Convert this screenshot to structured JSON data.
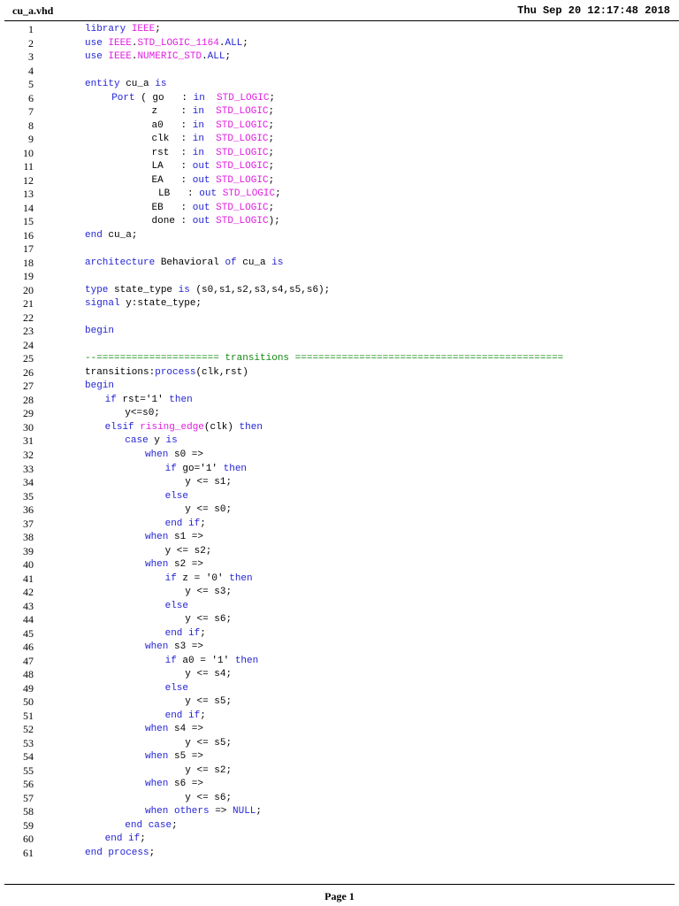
{
  "header": {
    "filename": "cu_a.vhd",
    "datetime": "Thu Sep 20 12:17:48 2018"
  },
  "footer": {
    "page": "Page 1"
  },
  "colors": {
    "keyword": "#2424d4",
    "type": "#e01ee0",
    "comment": "#128a12"
  },
  "lines": [
    {
      "n": "1",
      "tokens": [
        [
          "k",
          "library"
        ],
        [
          "p",
          " "
        ],
        [
          "m",
          "IEEE"
        ],
        [
          "p",
          ";"
        ]
      ]
    },
    {
      "n": "2",
      "tokens": [
        [
          "k",
          "use"
        ],
        [
          "p",
          " "
        ],
        [
          "m",
          "IEEE"
        ],
        [
          "p",
          "."
        ],
        [
          "m",
          "STD_LOGIC_1164"
        ],
        [
          "p",
          "."
        ],
        [
          "k",
          "ALL"
        ],
        [
          "p",
          ";"
        ]
      ]
    },
    {
      "n": "3",
      "tokens": [
        [
          "k",
          "use"
        ],
        [
          "p",
          " "
        ],
        [
          "m",
          "IEEE"
        ],
        [
          "p",
          "."
        ],
        [
          "m",
          "NUMERIC_STD"
        ],
        [
          "p",
          "."
        ],
        [
          "k",
          "ALL"
        ],
        [
          "p",
          ";"
        ]
      ]
    },
    {
      "n": "4",
      "tokens": []
    },
    {
      "n": "5",
      "tokens": [
        [
          "k",
          "entity"
        ],
        [
          "p",
          " cu_a "
        ],
        [
          "k",
          "is"
        ]
      ]
    },
    {
      "n": "6",
      "tokens": [
        [
          "p",
          "    "
        ],
        [
          "k",
          "Port"
        ],
        [
          "p",
          " ( go   : "
        ],
        [
          "k",
          "in"
        ],
        [
          "p",
          "  "
        ],
        [
          "m",
          "STD_LOGIC"
        ],
        [
          "p",
          ";"
        ]
      ]
    },
    {
      "n": "7",
      "tokens": [
        [
          "p",
          "          z    : "
        ],
        [
          "k",
          "in"
        ],
        [
          "p",
          "  "
        ],
        [
          "m",
          "STD_LOGIC"
        ],
        [
          "p",
          ";"
        ]
      ]
    },
    {
      "n": "8",
      "tokens": [
        [
          "p",
          "          a0   : "
        ],
        [
          "k",
          "in"
        ],
        [
          "p",
          "  "
        ],
        [
          "m",
          "STD_LOGIC"
        ],
        [
          "p",
          ";"
        ]
      ]
    },
    {
      "n": "9",
      "tokens": [
        [
          "p",
          "          clk  : "
        ],
        [
          "k",
          "in"
        ],
        [
          "p",
          "  "
        ],
        [
          "m",
          "STD_LOGIC"
        ],
        [
          "p",
          ";"
        ]
      ]
    },
    {
      "n": "10",
      "tokens": [
        [
          "p",
          "          rst  : "
        ],
        [
          "k",
          "in"
        ],
        [
          "p",
          "  "
        ],
        [
          "m",
          "STD_LOGIC"
        ],
        [
          "p",
          ";"
        ]
      ]
    },
    {
      "n": "11",
      "tokens": [
        [
          "p",
          "          LA   : "
        ],
        [
          "k",
          "out"
        ],
        [
          "p",
          " "
        ],
        [
          "m",
          "STD_LOGIC"
        ],
        [
          "p",
          ";"
        ]
      ]
    },
    {
      "n": "12",
      "tokens": [
        [
          "p",
          "          EA   : "
        ],
        [
          "k",
          "out"
        ],
        [
          "p",
          " "
        ],
        [
          "m",
          "STD_LOGIC"
        ],
        [
          "p",
          ";"
        ]
      ]
    },
    {
      "n": "13",
      "tokens": [
        [
          "p",
          "           LB   : "
        ],
        [
          "k",
          "out"
        ],
        [
          "p",
          " "
        ],
        [
          "m",
          "STD_LOGIC"
        ],
        [
          "p",
          ";"
        ]
      ]
    },
    {
      "n": "14",
      "tokens": [
        [
          "p",
          "          EB   : "
        ],
        [
          "k",
          "out"
        ],
        [
          "p",
          " "
        ],
        [
          "m",
          "STD_LOGIC"
        ],
        [
          "p",
          ";"
        ]
      ]
    },
    {
      "n": "15",
      "tokens": [
        [
          "p",
          "          done : "
        ],
        [
          "k",
          "out"
        ],
        [
          "p",
          " "
        ],
        [
          "m",
          "STD_LOGIC"
        ],
        [
          "p",
          ");"
        ]
      ]
    },
    {
      "n": "16",
      "tokens": [
        [
          "k",
          "end"
        ],
        [
          "p",
          " cu_a;"
        ]
      ]
    },
    {
      "n": "17",
      "tokens": []
    },
    {
      "n": "18",
      "tokens": [
        [
          "k",
          "architecture"
        ],
        [
          "p",
          " Behavioral "
        ],
        [
          "k",
          "of"
        ],
        [
          "p",
          " cu_a "
        ],
        [
          "k",
          "is"
        ]
      ]
    },
    {
      "n": "19",
      "tokens": []
    },
    {
      "n": "20",
      "tokens": [
        [
          "k",
          "type"
        ],
        [
          "p",
          " state_type "
        ],
        [
          "k",
          "is"
        ],
        [
          "p",
          " (s0,s1,s2,s3,s4,s5,s6);"
        ]
      ]
    },
    {
      "n": "21",
      "tokens": [
        [
          "k",
          "signal"
        ],
        [
          "p",
          " y:state_type;"
        ]
      ]
    },
    {
      "n": "22",
      "tokens": []
    },
    {
      "n": "23",
      "tokens": [
        [
          "k",
          "begin"
        ]
      ]
    },
    {
      "n": "24",
      "tokens": []
    },
    {
      "n": "25",
      "tokens": [
        [
          "c",
          "--===================== transitions =============================================="
        ]
      ]
    },
    {
      "n": "26",
      "tokens": [
        [
          "p",
          "transitions:"
        ],
        [
          "k",
          "process"
        ],
        [
          "p",
          "(clk,rst)"
        ]
      ]
    },
    {
      "n": "27",
      "tokens": [
        [
          "k",
          "begin"
        ]
      ]
    },
    {
      "n": "28",
      "tokens": [
        [
          "p",
          "   "
        ],
        [
          "k",
          "if"
        ],
        [
          "p",
          " rst='1' "
        ],
        [
          "k",
          "then"
        ]
      ]
    },
    {
      "n": "29",
      "tokens": [
        [
          "p",
          "      y<=s0;"
        ]
      ]
    },
    {
      "n": "30",
      "tokens": [
        [
          "p",
          "   "
        ],
        [
          "k",
          "elsif"
        ],
        [
          "p",
          " "
        ],
        [
          "m",
          "rising_edge"
        ],
        [
          "p",
          "(clk) "
        ],
        [
          "k",
          "then"
        ]
      ]
    },
    {
      "n": "31",
      "tokens": [
        [
          "p",
          "      "
        ],
        [
          "k",
          "case"
        ],
        [
          "p",
          " y "
        ],
        [
          "k",
          "is"
        ]
      ]
    },
    {
      "n": "32",
      "tokens": [
        [
          "p",
          "         "
        ],
        [
          "k",
          "when"
        ],
        [
          "p",
          " s0 =>"
        ]
      ]
    },
    {
      "n": "33",
      "tokens": [
        [
          "p",
          "            "
        ],
        [
          "k",
          "if"
        ],
        [
          "p",
          " go='1' "
        ],
        [
          "k",
          "then"
        ]
      ]
    },
    {
      "n": "34",
      "tokens": [
        [
          "p",
          "               y <= s1;"
        ]
      ]
    },
    {
      "n": "35",
      "tokens": [
        [
          "p",
          "            "
        ],
        [
          "k",
          "else"
        ]
      ]
    },
    {
      "n": "36",
      "tokens": [
        [
          "p",
          "               y <= s0;"
        ]
      ]
    },
    {
      "n": "37",
      "tokens": [
        [
          "p",
          "            "
        ],
        [
          "k",
          "end if"
        ],
        [
          "p",
          ";"
        ]
      ]
    },
    {
      "n": "38",
      "tokens": [
        [
          "p",
          "         "
        ],
        [
          "k",
          "when"
        ],
        [
          "p",
          " s1 =>"
        ]
      ]
    },
    {
      "n": "39",
      "tokens": [
        [
          "p",
          "            y <= s2;"
        ]
      ]
    },
    {
      "n": "40",
      "tokens": [
        [
          "p",
          "         "
        ],
        [
          "k",
          "when"
        ],
        [
          "p",
          " s2 =>"
        ]
      ]
    },
    {
      "n": "41",
      "tokens": [
        [
          "p",
          "            "
        ],
        [
          "k",
          "if"
        ],
        [
          "p",
          " z = '0' "
        ],
        [
          "k",
          "then"
        ]
      ]
    },
    {
      "n": "42",
      "tokens": [
        [
          "p",
          "               y <= s3;"
        ]
      ]
    },
    {
      "n": "43",
      "tokens": [
        [
          "p",
          "            "
        ],
        [
          "k",
          "else"
        ]
      ]
    },
    {
      "n": "44",
      "tokens": [
        [
          "p",
          "               y <= s6;"
        ]
      ]
    },
    {
      "n": "45",
      "tokens": [
        [
          "p",
          "            "
        ],
        [
          "k",
          "end if"
        ],
        [
          "p",
          ";"
        ]
      ]
    },
    {
      "n": "46",
      "tokens": [
        [
          "p",
          "         "
        ],
        [
          "k",
          "when"
        ],
        [
          "p",
          " s3 =>"
        ]
      ]
    },
    {
      "n": "47",
      "tokens": [
        [
          "p",
          "            "
        ],
        [
          "k",
          "if"
        ],
        [
          "p",
          " a0 = '1' "
        ],
        [
          "k",
          "then"
        ]
      ]
    },
    {
      "n": "48",
      "tokens": [
        [
          "p",
          "               y <= s4;"
        ]
      ]
    },
    {
      "n": "49",
      "tokens": [
        [
          "p",
          "            "
        ],
        [
          "k",
          "else"
        ]
      ]
    },
    {
      "n": "50",
      "tokens": [
        [
          "p",
          "               y <= s5;"
        ]
      ]
    },
    {
      "n": "51",
      "tokens": [
        [
          "p",
          "            "
        ],
        [
          "k",
          "end if"
        ],
        [
          "p",
          ";"
        ]
      ]
    },
    {
      "n": "52",
      "tokens": [
        [
          "p",
          "         "
        ],
        [
          "k",
          "when"
        ],
        [
          "p",
          " s4 =>"
        ]
      ]
    },
    {
      "n": "53",
      "tokens": [
        [
          "p",
          "               y <= s5;"
        ]
      ]
    },
    {
      "n": "54",
      "tokens": [
        [
          "p",
          "         "
        ],
        [
          "k",
          "when"
        ],
        [
          "p",
          " s5 =>"
        ]
      ]
    },
    {
      "n": "55",
      "tokens": [
        [
          "p",
          "               y <= s2;"
        ]
      ]
    },
    {
      "n": "56",
      "tokens": [
        [
          "p",
          "         "
        ],
        [
          "k",
          "when"
        ],
        [
          "p",
          " s6 =>"
        ]
      ]
    },
    {
      "n": "57",
      "tokens": [
        [
          "p",
          "               y <= s6;"
        ]
      ]
    },
    {
      "n": "58",
      "tokens": [
        [
          "p",
          "         "
        ],
        [
          "k",
          "when others"
        ],
        [
          "p",
          " => "
        ],
        [
          "k",
          "NULL"
        ],
        [
          "p",
          ";"
        ]
      ]
    },
    {
      "n": "59",
      "tokens": [
        [
          "p",
          "      "
        ],
        [
          "k",
          "end case"
        ],
        [
          "p",
          ";"
        ]
      ]
    },
    {
      "n": "60",
      "tokens": [
        [
          "p",
          "   "
        ],
        [
          "k",
          "end if"
        ],
        [
          "p",
          ";"
        ]
      ]
    },
    {
      "n": "61",
      "tokens": [
        [
          "k",
          "end process"
        ],
        [
          "p",
          ";"
        ]
      ]
    }
  ]
}
